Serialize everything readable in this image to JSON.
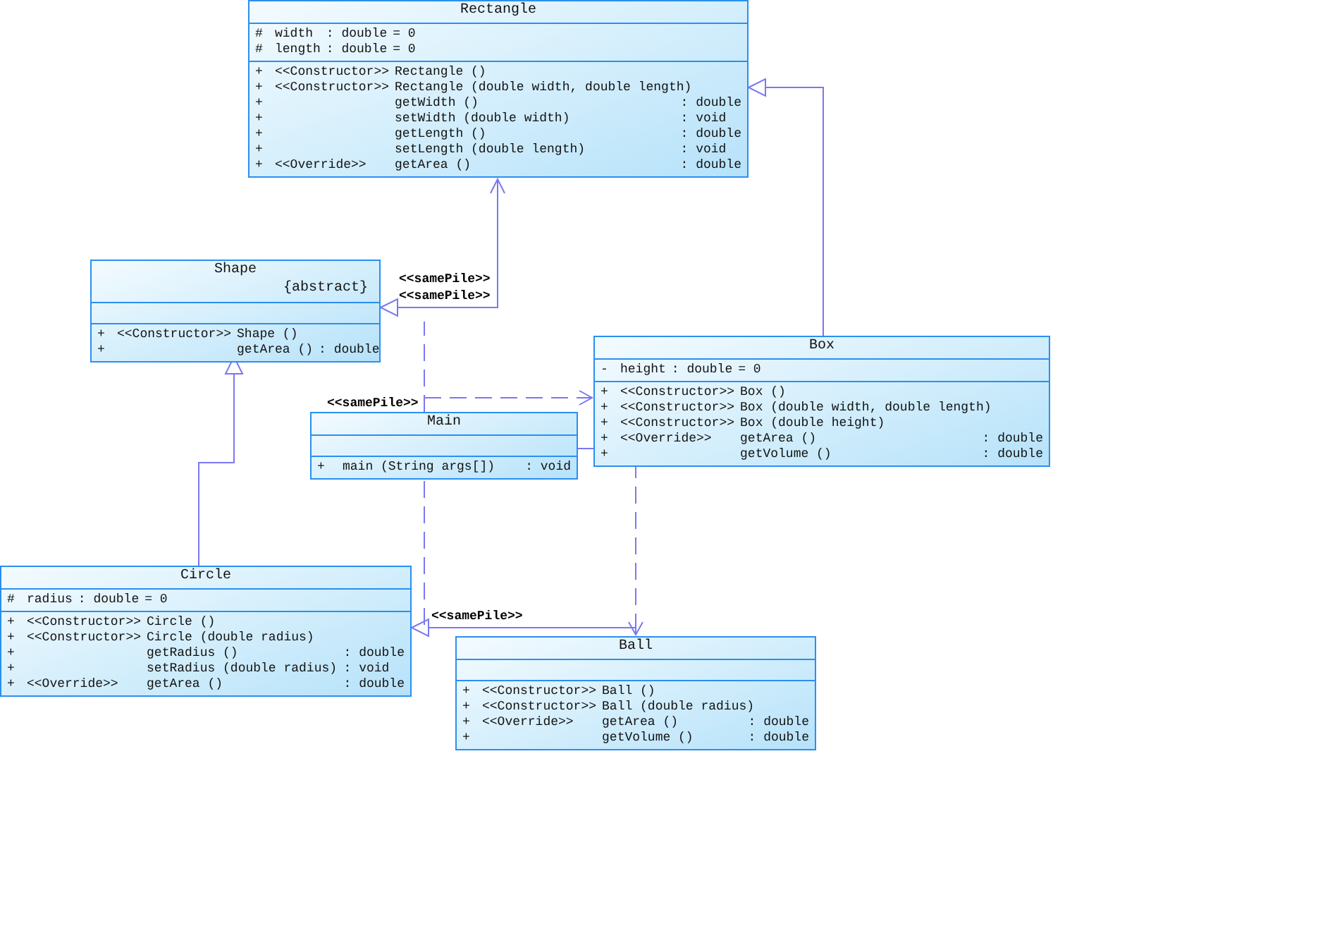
{
  "classes": [
    {
      "name": "Rectangle",
      "attributes": [
        {
          "visibility": "#",
          "name": "width",
          "type": ": double",
          "default": "= 0"
        },
        {
          "visibility": "#",
          "name": "length",
          "type": ": double",
          "default": "= 0"
        }
      ],
      "operations": [
        {
          "visibility": "+",
          "stereotype": "<<Constructor>>",
          "signature": "Rectangle ()"
        },
        {
          "visibility": "+",
          "stereotype": "<<Constructor>>",
          "signature": "Rectangle (double width, double length)"
        },
        {
          "visibility": "+",
          "signature": "getWidth ()",
          "return_type": ": double"
        },
        {
          "visibility": "+",
          "signature": "setWidth (double width)",
          "return_type": ": void"
        },
        {
          "visibility": "+",
          "signature": "getLength ()",
          "return_type": ": double"
        },
        {
          "visibility": "+",
          "signature": "setLength (double length)",
          "return_type": ": void"
        },
        {
          "visibility": "+",
          "stereotype": "<<Override>>",
          "signature": "getArea ()",
          "return_type": ": double"
        }
      ]
    },
    {
      "name": "Shape",
      "property": "{abstract}",
      "operations": [
        {
          "visibility": "+",
          "stereotype": "<<Constructor>>",
          "signature": "Shape ()"
        },
        {
          "visibility": "+",
          "signature": "getArea ()",
          "return_type": ": double"
        }
      ]
    },
    {
      "name": "Box",
      "attributes": [
        {
          "visibility": "-",
          "name": "height",
          "type": ": double",
          "default": "= 0"
        }
      ],
      "operations": [
        {
          "visibility": "+",
          "stereotype": "<<Constructor>>",
          "signature": "Box ()"
        },
        {
          "visibility": "+",
          "stereotype": "<<Constructor>>",
          "signature": "Box (double width, double length)"
        },
        {
          "visibility": "+",
          "stereotype": "<<Constructor>>",
          "signature": "Box (double height)"
        },
        {
          "visibility": "+",
          "stereotype": "<<Override>>",
          "signature": "getArea ()",
          "return_type": ": double"
        },
        {
          "visibility": "+",
          "signature": "getVolume ()",
          "return_type": ": double"
        }
      ]
    },
    {
      "name": "Main",
      "operations": [
        {
          "visibility": "+",
          "signature": "main (String args[])",
          "return_type": ": void"
        }
      ]
    },
    {
      "name": "Circle",
      "attributes": [
        {
          "visibility": "#",
          "name": "radius",
          "type": ": double",
          "default": "= 0"
        }
      ],
      "operations": [
        {
          "visibility": "+",
          "stereotype": "<<Constructor>>",
          "signature": "Circle ()"
        },
        {
          "visibility": "+",
          "stereotype": "<<Constructor>>",
          "signature": "Circle (double radius)"
        },
        {
          "visibility": "+",
          "signature": "getRadius ()",
          "return_type": ": double"
        },
        {
          "visibility": "+",
          "signature": "setRadius (double radius)",
          "return_type": ": void"
        },
        {
          "visibility": "+",
          "stereotype": "<<Override>>",
          "signature": "getArea ()",
          "return_type": ": double"
        }
      ]
    },
    {
      "name": "Ball",
      "operations": [
        {
          "visibility": "+",
          "stereotype": "<<Constructor>>",
          "signature": "Ball ()"
        },
        {
          "visibility": "+",
          "stereotype": "<<Constructor>>",
          "signature": "Ball (double radius)"
        },
        {
          "visibility": "+",
          "stereotype": "<<Override>>",
          "signature": "getArea ()",
          "return_type": ": double"
        },
        {
          "visibility": "+",
          "signature": "getVolume ()",
          "return_type": ": double"
        }
      ]
    }
  ],
  "labels": [
    "<<samePile>>",
    "<<samePile>>",
    "<<samePile>>",
    "<<samePile>>"
  ]
}
